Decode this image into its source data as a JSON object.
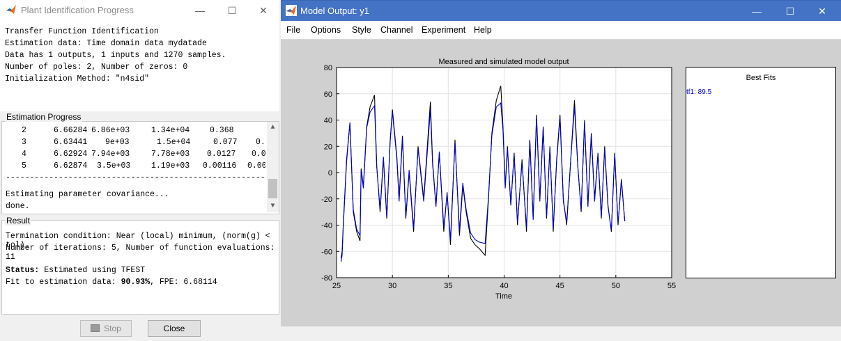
{
  "plant_window": {
    "title": "Plant Identification Progress",
    "controls": {
      "minimize": "—",
      "maximize": "☐",
      "close": "✕"
    },
    "info_lines": [
      "Transfer Function Identification",
      "Estimation data: Time domain data mydatade",
      "Data has 1 outputs, 1 inputs and 1270 samples.",
      "Number of poles: 2, Number of zeros: 0",
      "Initialization Method: \"n4sid\""
    ],
    "progress_label": "Estimation Progress",
    "progress_rows": [
      [
        "2",
        "6.66284",
        "6.86e+03",
        "1.34e+04",
        "0.368",
        ""
      ],
      [
        "3",
        "6.63441",
        "9e+03",
        "1.5e+04",
        "0.077",
        "0."
      ],
      [
        "4",
        "6.62924",
        "7.94e+03",
        "7.78e+03",
        "0.0127",
        "0.0"
      ],
      [
        "5",
        "6.62874",
        "3.5e+03",
        "1.19e+03",
        "0.00116",
        "0.00"
      ]
    ],
    "divider": "----------------------------------------------------------",
    "progress_tail": [
      "Estimating parameter covariance...",
      "done."
    ],
    "result_label": "Result",
    "result_lines": [
      "Termination condition: Near (local) minimum, (norm(g) < tol).",
      "Number of iterations: 5, Number of function evaluations: 11"
    ],
    "status_prefix": "Status:",
    "status_text": " Estimated using TFEST",
    "fit_prefix": "Fit to estimation data: ",
    "fit_value": "90.93%",
    "fit_suffix": ", FPE: 6.68114",
    "stop_label": "Stop",
    "close_label": "Close"
  },
  "model_window": {
    "title": "Model Output: y1",
    "controls": {
      "minimize": "—",
      "maximize": "☐",
      "close": "✕"
    },
    "menu": [
      "File",
      "Options",
      "Style",
      "Channel",
      "Experiment",
      "Help"
    ],
    "best_fits_title": "Best Fits",
    "best_fits_entry": "tf1: 89.5",
    "colors": {
      "measured": "#000000",
      "simulated": "#0000cc",
      "titlebar": "#4472c4"
    }
  },
  "chart_data": {
    "type": "line",
    "title": "Measured and simulated model output",
    "xlabel": "Time",
    "ylabel": "",
    "xlim": [
      25,
      55
    ],
    "ylim": [
      -80,
      80
    ],
    "xticks": [
      25,
      30,
      35,
      40,
      45,
      50,
      55
    ],
    "yticks": [
      -80,
      -60,
      -40,
      -20,
      0,
      20,
      40,
      60,
      80
    ],
    "grid": true,
    "series": [
      {
        "name": "",
        "color": "#000000",
        "x": [
          25.4,
          25.5,
          25.6,
          25.9,
          26.2,
          26.5,
          26.8,
          27.1,
          27.2,
          27.4,
          27.7,
          28.0,
          28.4,
          28.6,
          28.9,
          29.2,
          29.5,
          29.8,
          30.0,
          30.4,
          30.6,
          30.9,
          31.2,
          31.5,
          31.9,
          32.3,
          32.8,
          33.4,
          33.6,
          33.9,
          34.2,
          34.6,
          34.9,
          35.2,
          35.6,
          36.0,
          36.3,
          36.6,
          37.0,
          37.4,
          37.8,
          38.3,
          38.6,
          38.9,
          39.3,
          39.7,
          39.9,
          40.1,
          40.3,
          40.6,
          40.9,
          41.2,
          41.6,
          42.0,
          42.3,
          42.6,
          42.9,
          43.2,
          43.5,
          43.8,
          44.1,
          44.4,
          44.7,
          45.0,
          45.3,
          45.6,
          46.0,
          46.3,
          46.6,
          46.9,
          47.2,
          47.5,
          47.8,
          48.1,
          48.4,
          48.7,
          49.0,
          49.3,
          49.6,
          49.9,
          50.2,
          50.5,
          50.8
        ],
        "y": [
          -65,
          -60,
          -40,
          10,
          38,
          -30,
          -45,
          -52,
          3,
          -10,
          35,
          50,
          59,
          5,
          -30,
          10,
          -35,
          25,
          48,
          12,
          -20,
          28,
          -35,
          0,
          -45,
          20,
          -20,
          54,
          8,
          -25,
          15,
          -45,
          -15,
          -55,
          25,
          -48,
          -10,
          -30,
          -50,
          -55,
          -58,
          -63,
          -20,
          30,
          55,
          66,
          35,
          -10,
          20,
          -25,
          15,
          -40,
          10,
          -45,
          25,
          -35,
          44,
          -20,
          35,
          -35,
          20,
          -45,
          10,
          44,
          -20,
          -40,
          15,
          55,
          5,
          -30,
          40,
          -25,
          30,
          -20,
          15,
          -35,
          20,
          -25,
          -45,
          15,
          -40,
          -5,
          -37
        ]
      },
      {
        "name": "",
        "color": "#0000cc",
        "x": [
          25.4,
          25.5,
          25.6,
          25.9,
          26.2,
          26.5,
          26.8,
          27.1,
          27.2,
          27.4,
          27.7,
          28.0,
          28.4,
          28.6,
          28.9,
          29.2,
          29.5,
          29.8,
          30.0,
          30.4,
          30.6,
          30.9,
          31.2,
          31.5,
          31.9,
          32.3,
          32.8,
          33.4,
          33.6,
          33.9,
          34.2,
          34.6,
          34.9,
          35.2,
          35.6,
          36.0,
          36.3,
          36.6,
          37.0,
          37.4,
          37.8,
          38.3,
          38.6,
          38.9,
          39.3,
          39.7,
          39.9,
          40.1,
          40.3,
          40.6,
          40.9,
          41.2,
          41.6,
          42.0,
          42.3,
          42.6,
          42.9,
          43.2,
          43.5,
          43.8,
          44.1,
          44.4,
          44.7,
          45.0,
          45.3,
          45.6,
          46.0,
          46.3,
          46.6,
          46.9,
          47.2,
          47.5,
          47.8,
          48.1,
          48.4,
          48.7,
          49.0,
          49.3,
          49.6,
          49.9,
          50.2,
          50.5,
          50.8
        ],
        "y": [
          -68,
          -63,
          -42,
          8,
          38,
          -28,
          -43,
          -48,
          2,
          -12,
          34,
          46,
          51,
          4,
          -28,
          12,
          -34,
          24,
          46,
          10,
          -22,
          26,
          -34,
          2,
          -42,
          18,
          -22,
          48,
          6,
          -26,
          16,
          -42,
          -16,
          -51,
          23,
          -44,
          -8,
          -28,
          -46,
          -51,
          -53,
          -54,
          -18,
          28,
          50,
          53,
          32,
          -12,
          18,
          -24,
          14,
          -38,
          8,
          -42,
          24,
          -36,
          42,
          -22,
          34,
          -34,
          18,
          -42,
          8,
          42,
          -22,
          -38,
          14,
          50,
          4,
          -28,
          38,
          -26,
          28,
          -22,
          14,
          -34,
          18,
          -26,
          -44,
          14,
          -39,
          -6,
          -37
        ]
      }
    ]
  }
}
